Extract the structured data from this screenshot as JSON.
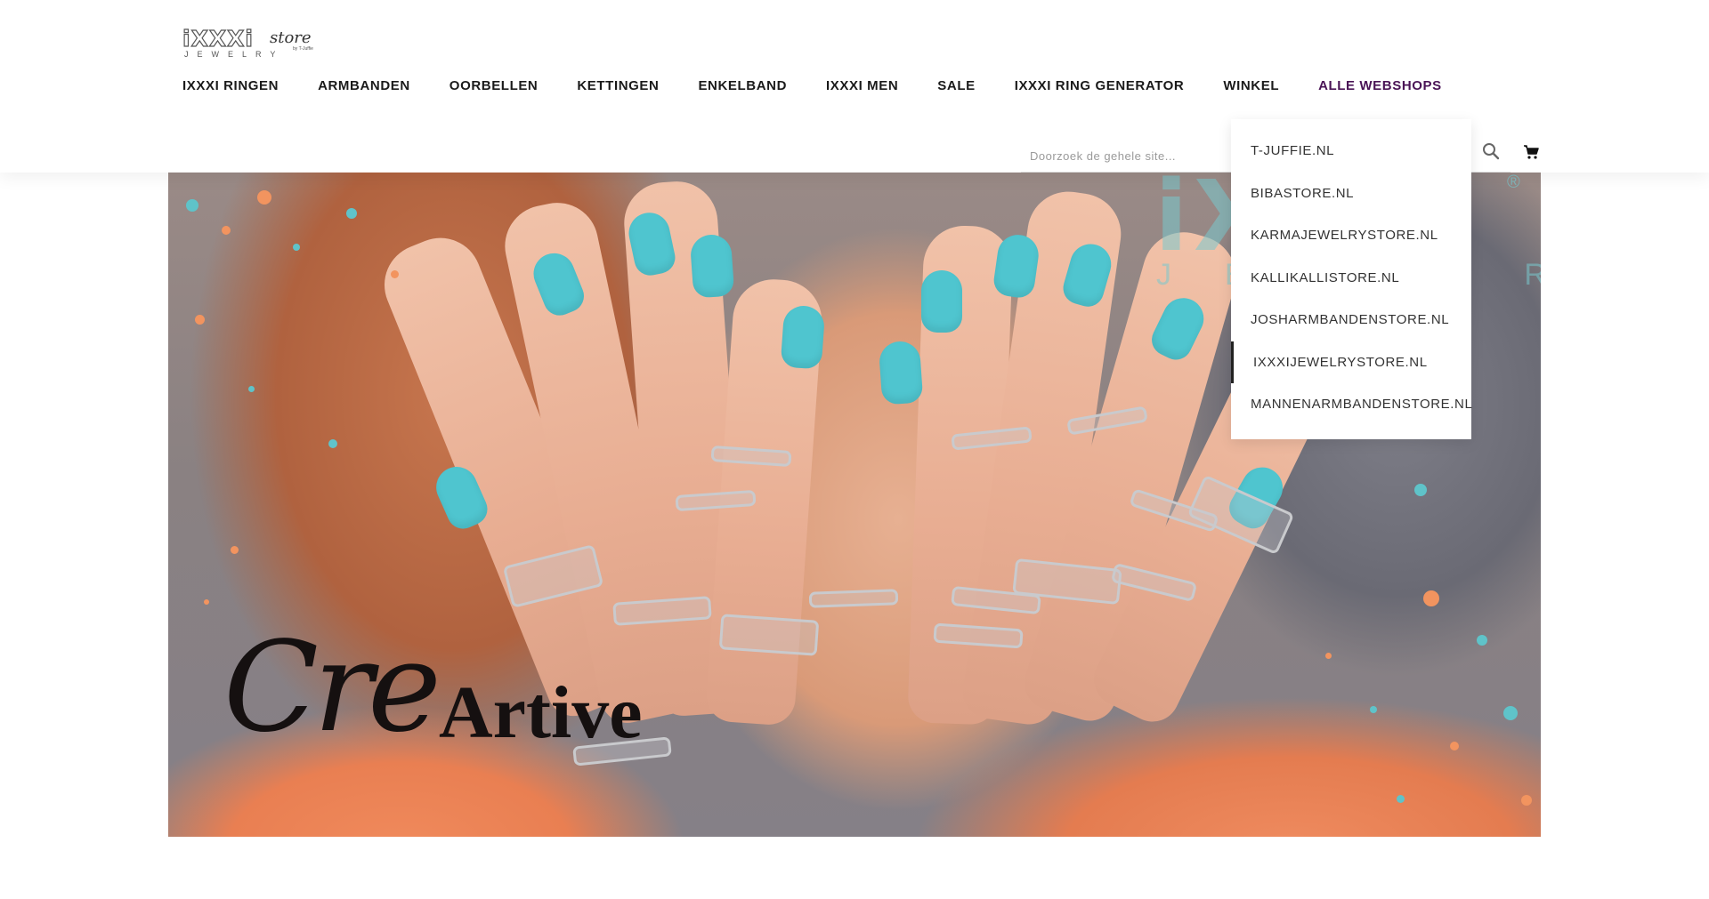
{
  "brand": {
    "logo_main": "iXXXi",
    "logo_store": "store",
    "logo_sub": "JEWELRY",
    "logo_by": "by T-Juffie"
  },
  "nav": {
    "items": [
      {
        "label": "IXXXI RINGEN"
      },
      {
        "label": "ARMBANDEN"
      },
      {
        "label": "OORBELLEN"
      },
      {
        "label": "KETTINGEN"
      },
      {
        "label": "ENKELBAND"
      },
      {
        "label": "IXXXI MEN"
      },
      {
        "label": "SALE"
      },
      {
        "label": "IXXXI RING GENERATOR"
      },
      {
        "label": "WINKEL"
      },
      {
        "label": "ALLE WEBSHOPS"
      }
    ],
    "active_index": 9,
    "active_color": "#4a1456"
  },
  "search": {
    "placeholder": "Doorzoek de gehele site...",
    "value": ""
  },
  "icons": {
    "search": "search-icon",
    "cart": "cart-icon"
  },
  "dropdown": {
    "items": [
      {
        "label": "T-JUFFIE.NL"
      },
      {
        "label": "BIBASTORE.NL"
      },
      {
        "label": "KARMAJEWELRYSTORE.NL"
      },
      {
        "label": "KALLIKALLISTORE.NL"
      },
      {
        "label": "JOSHARMBANDENSTORE.NL"
      },
      {
        "label": "IXXXIJEWELRYSTORE.NL"
      },
      {
        "label": "MANNENARMBANDENSTORE.NL"
      }
    ],
    "hovered_index": 5
  },
  "hero": {
    "watermark_main": "iXXXi",
    "watermark_sub": "JEWELRY",
    "watermark_reg": "®",
    "title_script": "Cre",
    "title_serif": "Artive",
    "colors": {
      "nail": "#4fc5cf",
      "sweater": "#e97f52",
      "splatter_orange": "#f2945f",
      "splatter_teal": "#5fc3c9"
    }
  }
}
